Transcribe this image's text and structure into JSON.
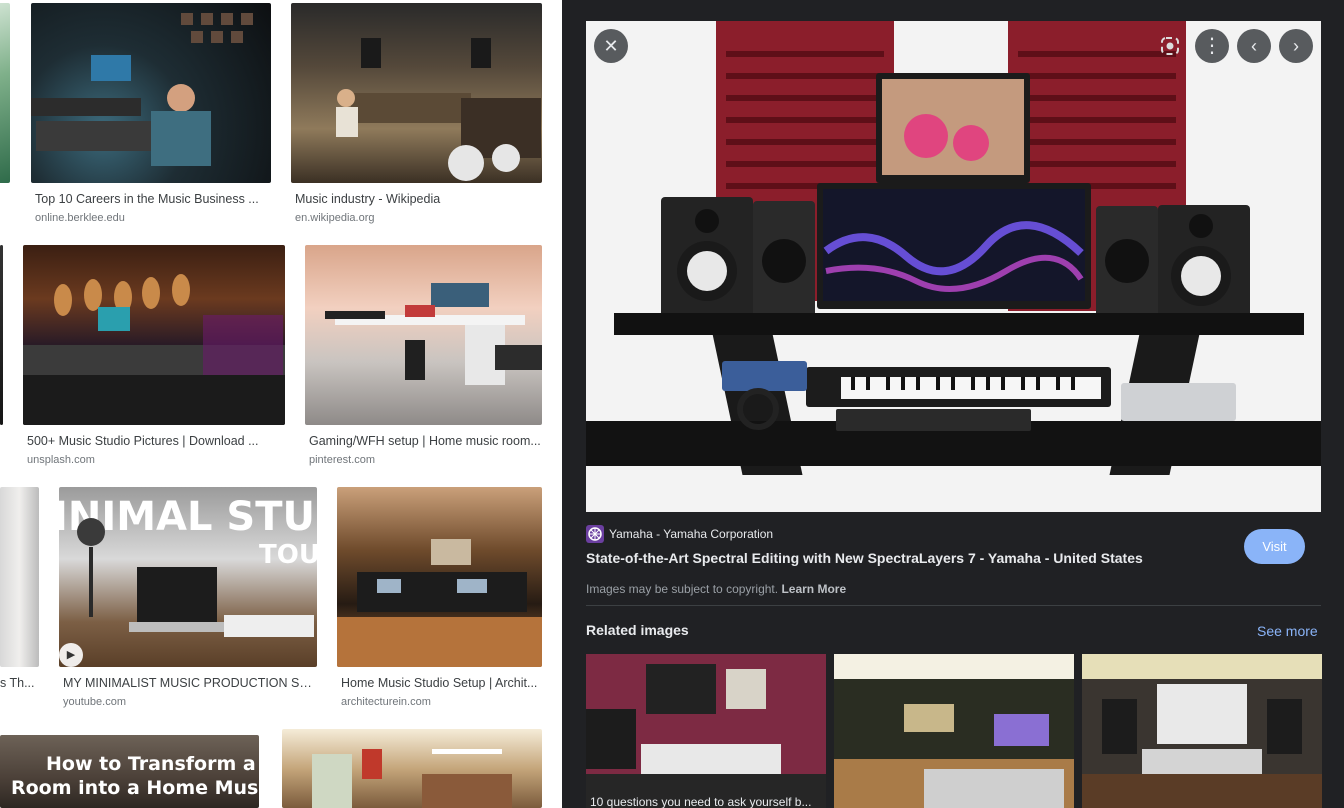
{
  "results": [
    {
      "title": "Top 10 Careers in the Music Business ...",
      "source": "online.berklee.edu"
    },
    {
      "title": "Music industry - Wikipedia",
      "source": "en.wikipedia.org"
    },
    {
      "title": "500+ Music Studio Pictures | Download ...",
      "source": "unsplash.com"
    },
    {
      "title": "Gaming/WFH setup | Home music room...",
      "source": "pinterest.com"
    },
    {
      "title": "s Th...",
      "source": ""
    },
    {
      "title": "MY MINIMALIST MUSIC PRODUCTION SET ...",
      "source": "youtube.com",
      "thumb_text_1": "INIMAL STUDIO",
      "thumb_text_2": "TOUR"
    },
    {
      "title": "Home Music Studio Setup | Archit...",
      "source": "architecturein.com"
    },
    {
      "title": "",
      "source": "",
      "thumb_text_1": "How to Transform a Spare",
      "thumb_text_2": "Room into a Home Music Studio"
    }
  ],
  "preview": {
    "source_name": "Yamaha - Yamaha Corporation",
    "title": "State-of-the-Art Spectral Editing with New SpectraLayers 7 - Yamaha - United States",
    "visit_label": "Visit",
    "copyright_text": "Images may be subject to copyright.",
    "learn_more": "Learn More",
    "related_heading": "Related images",
    "see_more": "See more",
    "related_caption": "10 questions you need to ask yourself b..."
  },
  "icons": {
    "close": "close-icon",
    "lens": "lens-icon",
    "more": "more-vert-icon",
    "prev": "chevron-left-icon",
    "next": "chevron-right-icon",
    "play": "play-icon"
  },
  "colors": {
    "panel_bg": "#202124",
    "accent": "#8ab4f8",
    "panel_red": "#8b1e2b"
  }
}
